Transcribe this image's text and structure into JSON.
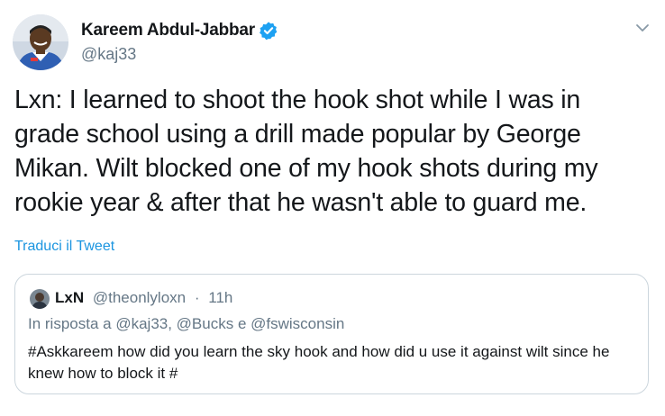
{
  "tweet": {
    "author": {
      "name": "Kareem Abdul-Jabbar",
      "handle": "@kaj33",
      "verified": true,
      "avatar_icon": "profile-photo"
    },
    "text": "Lxn: I learned to shoot the hook shot while I was in grade school using a drill made popular by George Mikan. Wilt blocked one of my hook shots during my rookie year & after that he wasn't able to guard me.",
    "translate_label": "Traduci il Tweet",
    "menu_icon": "chevron-down-icon"
  },
  "quoted_tweet": {
    "author": {
      "name": "LxN",
      "handle": "@theonlyloxn",
      "avatar_icon": "profile-photo"
    },
    "separator": "·",
    "time": "11h",
    "reply_context": "In risposta a @kaj33, @Bucks e @fswisconsin",
    "text": "#Askkareem  how did you learn the sky hook and how did u use it against wilt since he knew how to block it #"
  },
  "colors": {
    "text_primary": "#14171a",
    "text_secondary": "#657786",
    "link": "#1b95e0",
    "verified_badge": "#1da1f2",
    "border": "#ccd6dd"
  }
}
